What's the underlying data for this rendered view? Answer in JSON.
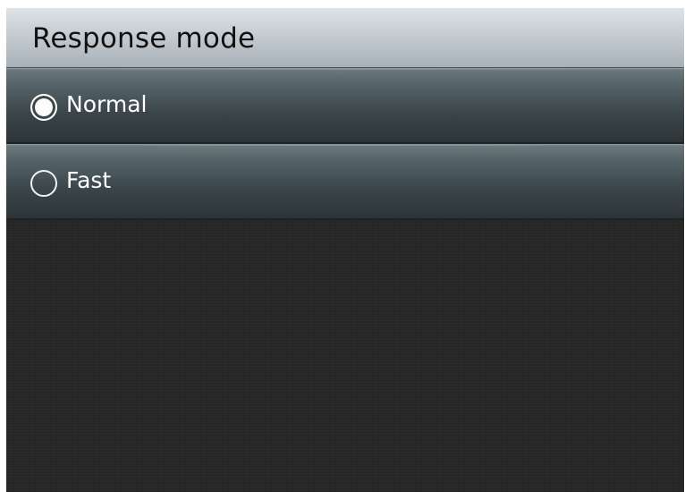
{
  "screen": {
    "title": "Response mode",
    "options": [
      {
        "label": "Normal",
        "selected": true
      },
      {
        "label": "Fast",
        "selected": false
      }
    ]
  },
  "colors": {
    "title_bar_top": "#dde3e7",
    "title_bar_bottom": "#a8b1b7",
    "option_bar_top": "#6d7a7e",
    "option_bar_bottom": "#2c3437",
    "background": "#242424",
    "text_light": "#ffffff",
    "text_dark": "#111111"
  },
  "icons": {
    "selected_radio": "radio-selected-icon",
    "unselected_radio": "radio-unselected-icon"
  }
}
